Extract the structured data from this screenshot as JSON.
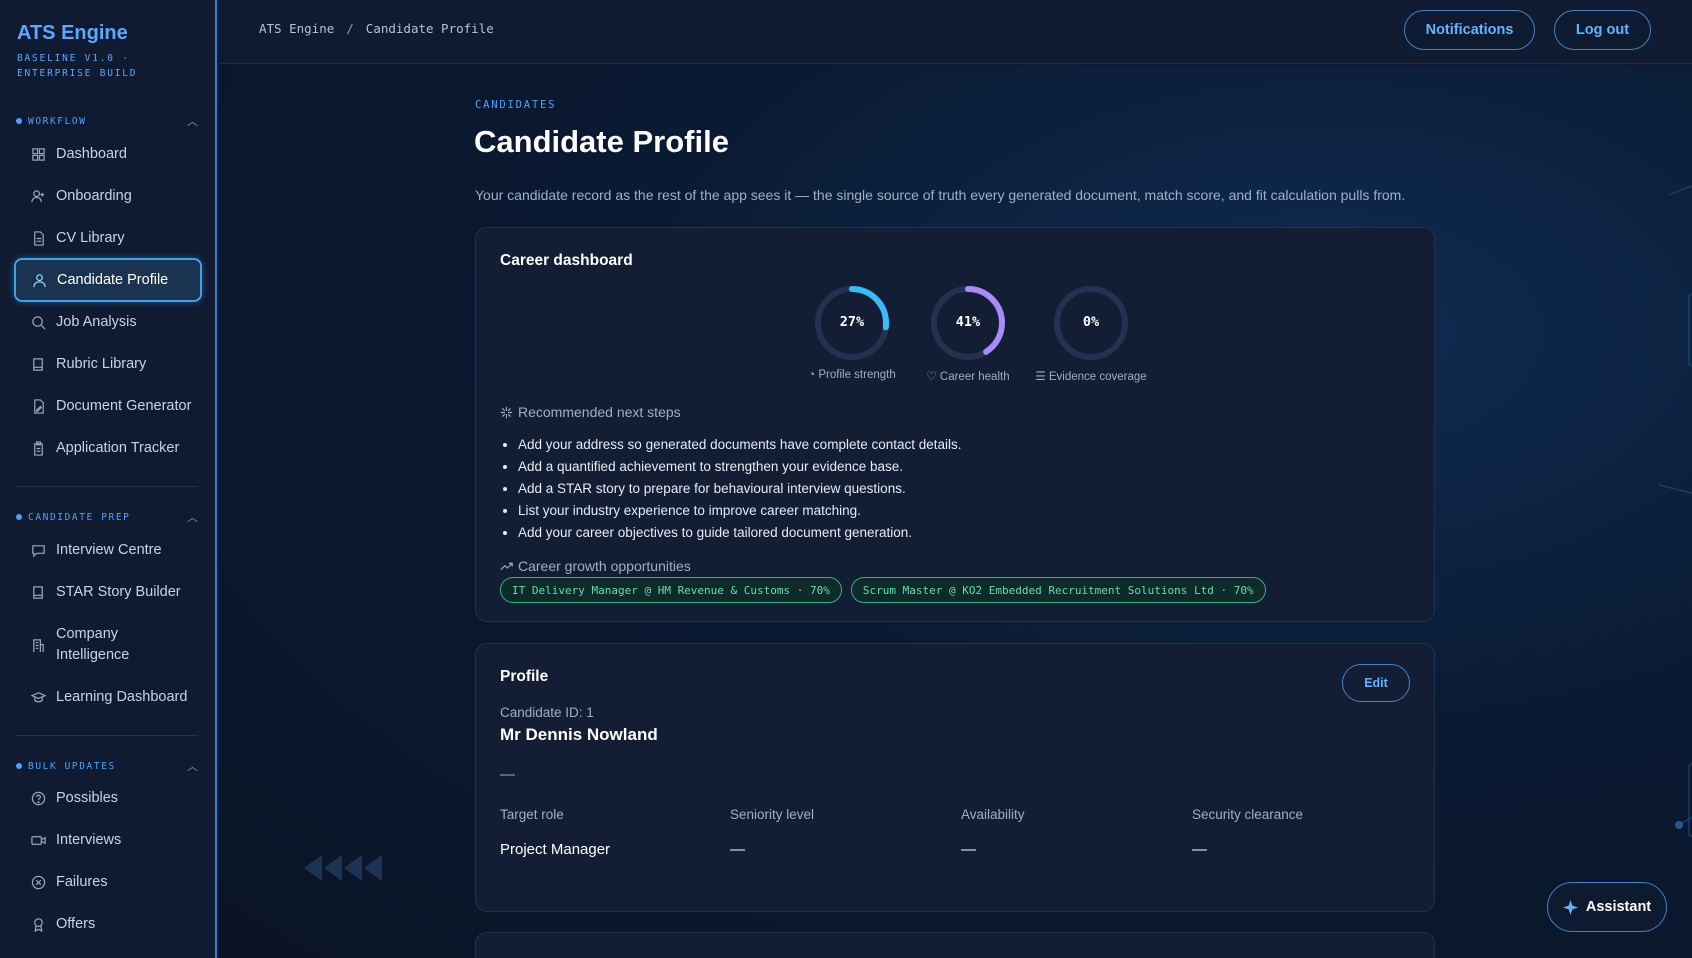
{
  "brand": {
    "title": "ATS Engine",
    "subtitle": "BASELINE V1.0 · ENTERPRISE BUILD"
  },
  "sidebar": {
    "sections": [
      {
        "label": "WORKFLOW",
        "items": [
          {
            "label": "Dashboard",
            "icon": "grid-icon"
          },
          {
            "label": "Onboarding",
            "icon": "user-plus-icon"
          },
          {
            "label": "CV Library",
            "icon": "document-icon"
          },
          {
            "label": "Candidate Profile",
            "icon": "user-icon",
            "active": true
          },
          {
            "label": "Job Analysis",
            "icon": "search-icon"
          },
          {
            "label": "Rubric Library",
            "icon": "book-icon"
          },
          {
            "label": "Document Generator",
            "icon": "file-edit-icon"
          },
          {
            "label": "Application Tracker",
            "icon": "clipboard-icon"
          }
        ]
      },
      {
        "label": "CANDIDATE PREP",
        "items": [
          {
            "label": "Interview Centre",
            "icon": "chat-icon"
          },
          {
            "label": "STAR Story Builder",
            "icon": "book-icon"
          },
          {
            "label": "Company Intelligence",
            "icon": "building-icon"
          },
          {
            "label": "Learning Dashboard",
            "icon": "graduation-cap-icon"
          }
        ]
      },
      {
        "label": "BULK UPDATES",
        "items": [
          {
            "label": "Possibles",
            "icon": "help-circle-icon"
          },
          {
            "label": "Interviews",
            "icon": "video-icon"
          },
          {
            "label": "Failures",
            "icon": "x-circle-icon"
          },
          {
            "label": "Offers",
            "icon": "award-icon"
          }
        ]
      }
    ]
  },
  "topbar": {
    "breadcrumb": [
      "ATS Engine",
      "Candidate Profile"
    ],
    "notifications_label": "Notifications",
    "logout_label": "Log out"
  },
  "page": {
    "eyebrow": "CANDIDATES",
    "title": "Candidate Profile",
    "description": "Your candidate record as the rest of the app sees it — the single source of truth every generated document, match score, and fit calculation pulls from."
  },
  "career_dashboard": {
    "title": "Career dashboard",
    "gauges": [
      {
        "label": "Profile strength",
        "value": 27,
        "display": "27%",
        "color": "#38bdf8",
        "icon": "gauge-icon"
      },
      {
        "label": "Career health",
        "value": 41,
        "display": "41%",
        "color": "#a78bfa",
        "icon": "heart-icon"
      },
      {
        "label": "Evidence coverage",
        "value": 0,
        "display": "0%",
        "color": "#38bdf8",
        "icon": "list-check-icon"
      }
    ],
    "next_steps_title": "Recommended next steps",
    "next_steps": [
      "Add your address so generated documents have complete contact details.",
      "Add a quantified achievement to strengthen your evidence base.",
      "Add a STAR story to prepare for behavioural interview questions.",
      "List your industry experience to improve career matching.",
      "Add your career objectives to guide tailored document generation."
    ],
    "growth_title": "Career growth opportunities",
    "opportunities": [
      "IT Delivery Manager @ HM Revenue & Customs · 70%",
      "Scrum Master @ KO2 Embedded Recruitment Solutions Ltd · 70%"
    ]
  },
  "profile": {
    "title": "Profile",
    "edit_label": "Edit",
    "candidate_id": "Candidate ID: 1",
    "name": "Mr Dennis Nowland",
    "headline": "—",
    "fields": [
      {
        "label": "Target role",
        "value": "Project Manager"
      },
      {
        "label": "Seniority level",
        "value": "—"
      },
      {
        "label": "Availability",
        "value": "—"
      },
      {
        "label": "Security clearance",
        "value": "—"
      }
    ]
  },
  "assistant_label": "Assistant"
}
